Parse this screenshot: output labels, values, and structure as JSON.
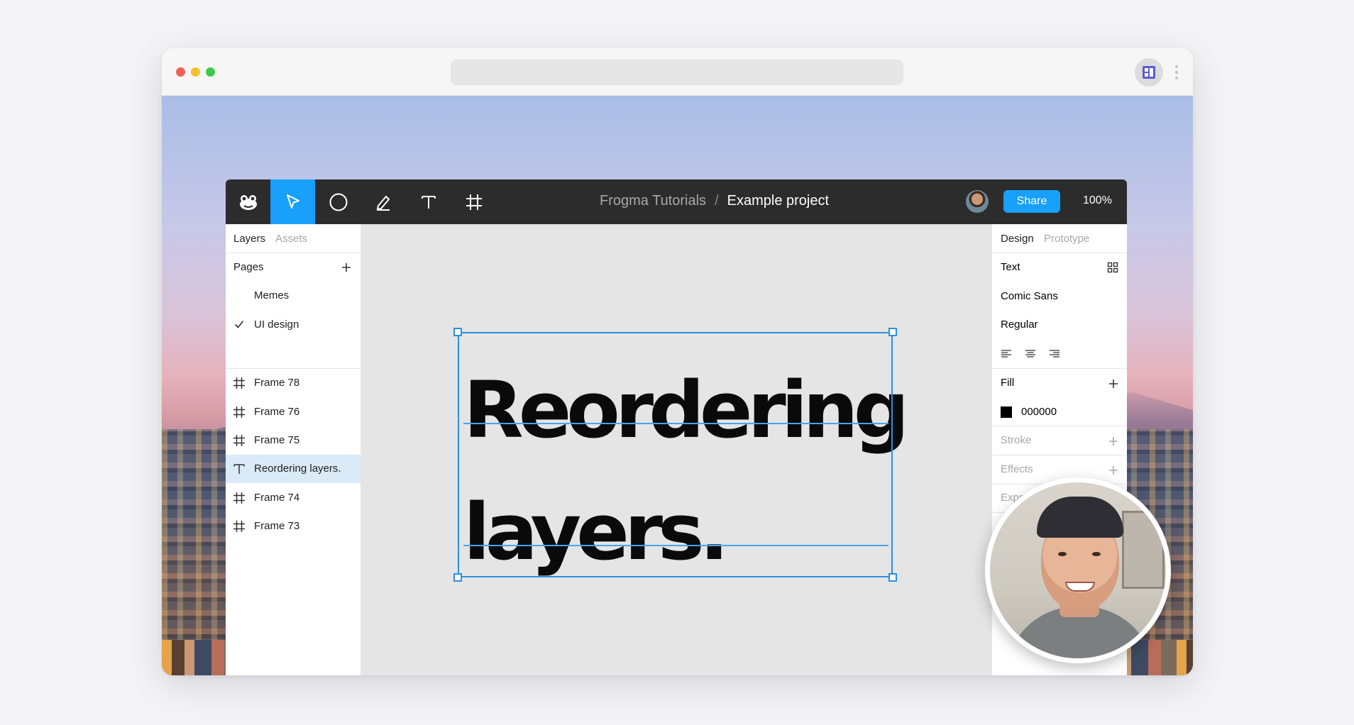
{
  "toolbar": {
    "tools": [
      "frog-logo",
      "move",
      "ellipse",
      "pen",
      "text",
      "frame"
    ],
    "active_tool": "move",
    "project_name": "Frogma Tutorials",
    "separator": "/",
    "file_name": "Example project",
    "share_label": "Share",
    "zoom": "100%"
  },
  "left_panel": {
    "tabs": [
      "Layers",
      "Assets"
    ],
    "active_tab": "Layers",
    "pages_header": "Pages",
    "pages": [
      {
        "label": "Memes",
        "checked": false
      },
      {
        "label": "UI design",
        "checked": true
      }
    ],
    "layers": [
      {
        "label": "Frame 78",
        "type": "frame"
      },
      {
        "label": "Frame 76",
        "type": "frame"
      },
      {
        "label": "Frame 75",
        "type": "frame"
      },
      {
        "label": "Reordering layers.",
        "type": "text",
        "selected": true
      },
      {
        "label": "Frame 74",
        "type": "frame"
      },
      {
        "label": "Frame 73",
        "type": "frame"
      }
    ]
  },
  "canvas": {
    "text_line1": "Reordering",
    "text_line2": "layers."
  },
  "right_panel": {
    "tabs": [
      "Design",
      "Prototype"
    ],
    "active_tab": "Design",
    "text_header": "Text",
    "font_family": "Comic Sans",
    "font_weight": "Regular",
    "fill_header": "Fill",
    "fill_color": "000000",
    "stroke_header": "Stroke",
    "effects_header": "Effects",
    "export_header": "Export"
  },
  "colors": {
    "accent": "#18a0fb",
    "toolbar_bg": "#2c2c2c",
    "selection": "#2b8fe0",
    "selected_row": "#daebf7"
  }
}
